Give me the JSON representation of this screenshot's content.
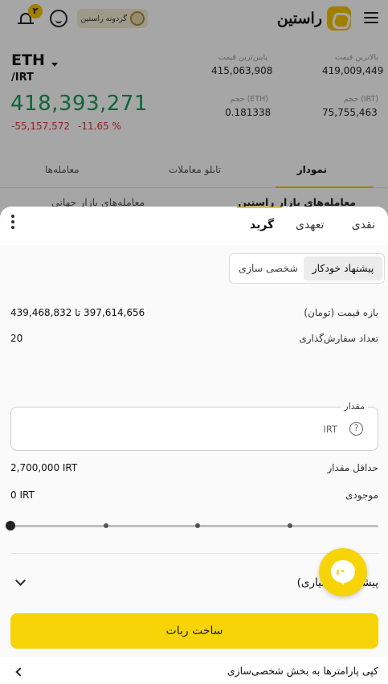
{
  "header": {
    "logo_text": "راستین",
    "wheel_label": "گردونه راستین",
    "notification_count": "۲"
  },
  "market": {
    "base": "ETH",
    "quote": "/IRT",
    "last_price": "418,393,271",
    "change_abs": "-55,157,572",
    "change_pct": "-11.65 %",
    "highest_label": "بالاترین قیمت",
    "highest_value": "419,009,449",
    "lowest_label": "پایین‌ترین قیمت",
    "lowest_value": "415,063,908",
    "vol_irt_label": "حجم (IRT)",
    "vol_irt_value": "75,755,463",
    "vol_eth_label": "حجم (ETH)",
    "vol_eth_value": "0.181338"
  },
  "page_tabs": {
    "chart": "نمودار",
    "orderbook": "تابلو معاملات",
    "trades": "معامله‌ها",
    "sub_left": "معامله‌های بازار جهانی",
    "sub_right": "معامله‌های بازار راستین"
  },
  "sheet": {
    "tabs": {
      "spot": "نقدی",
      "futures": "تعهدی",
      "grid": "گرید"
    },
    "segment": {
      "auto": "پیشنهاد خودکار",
      "custom": "شخصی سازی"
    },
    "price_range_label": "بازه قیمت (تومان)",
    "price_range_value": "397,614,656 تا 439,468,832",
    "order_count_label": "تعداد سفارش‌گذاری",
    "order_count_value": "20",
    "amount_label": "مقدار",
    "amount_unit": "IRT",
    "help_glyph": "?",
    "min_amount_label": "حداقل مقدار",
    "min_amount_value": "2,700,000 IRT",
    "balance_label": "موجودی",
    "balance_value": "0 IRT",
    "slider_value": 0,
    "advanced_label": "پیشرفته (اختیاری)",
    "create_bot_label": "ساخت ربات",
    "copy_params_label": "کپی پارامترها به بخش شخصی‌سازی"
  },
  "colors": {
    "accent": "#f7d408",
    "price_up": "#1a9a5a",
    "price_down": "#d33333"
  }
}
